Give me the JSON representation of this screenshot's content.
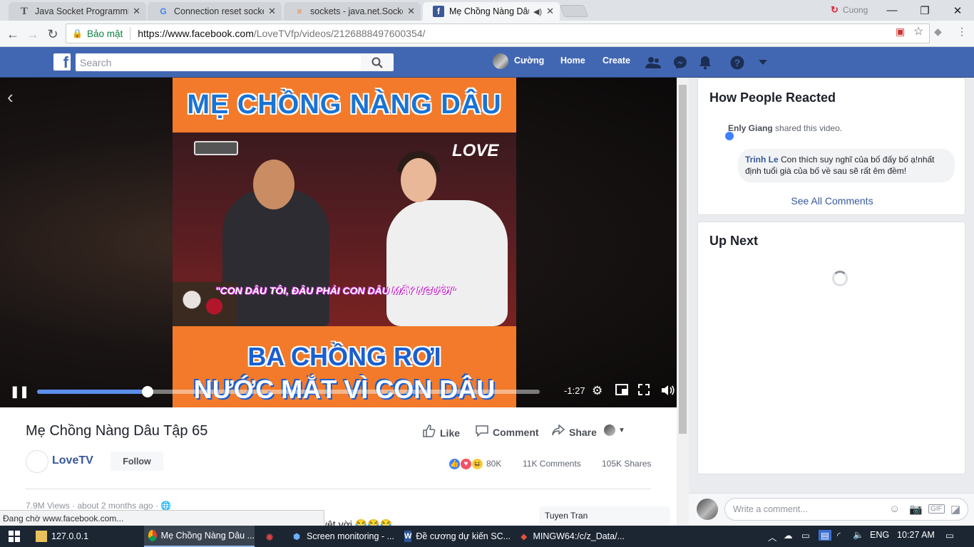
{
  "browser": {
    "tabs": [
      {
        "title": "Java Socket Programming",
        "icon": "T"
      },
      {
        "title": "Connection reset socket j",
        "icon": "G"
      },
      {
        "title": "sockets - java.net.SocketE",
        "icon": "stackoverflow-icon"
      },
      {
        "title": "Mẹ Chồng Nàng Dâu",
        "icon": "f",
        "active": true
      }
    ],
    "profile_name": "Cuong",
    "security_label": "Bảo mật",
    "url_host": "https://www.facebook.com",
    "url_path": "/LoveTVfp/videos/2126888497600354/"
  },
  "facebook": {
    "search_placeholder": "Search",
    "user_name": "Cường",
    "nav": [
      "Home",
      "Create"
    ]
  },
  "video": {
    "overlay_top": "MẸ CHỒNG NÀNG DÂU",
    "overlay_caption": "\"CON DÂU TÔI, ĐÂU PHẢI CON DÂU MẤY NGƯỜI\"",
    "overlay_bottom1": "BA CHỒNG RƠI",
    "overlay_bottom2": "NƯỚC MẮT VÌ CON DÂU",
    "watermark": "LOVE",
    "time_remaining": "-1:27",
    "progress": 0.22
  },
  "post": {
    "title": "Mẹ Chồng Nàng Dâu Tập 65",
    "actions": [
      "Like",
      "Comment",
      "Share"
    ],
    "page_name": "LoveTV",
    "follow_label": "Follow",
    "reactions_count": "80K",
    "comments_count": "11K Comments",
    "shares_count": "105K Shares",
    "views_line": "7.9M Views · about 2 months ago ·",
    "partial_text": "yêt vời 😂😂😂",
    "commenter_preview": "Tuyen Tran"
  },
  "status_bar": "Đang chờ www.facebook.com...",
  "sidebar": {
    "reacted_title": "How People Reacted",
    "share_user": "Enly Giang",
    "share_text": "shared this video.",
    "comment_user": "Trinh Le",
    "comment_text": "Con thích suy nghĩ của bố đấy bố ạ!nhất định tuổi già của bố về sau sẽ rất êm đềm!",
    "see_all": "See All Comments",
    "up_next_title": "Up Next",
    "comment_placeholder": "Write a comment..."
  },
  "taskbar": {
    "items": [
      {
        "label": "127.0.0.1"
      },
      {
        "label": "Mẹ Chồng Nàng Dâu ..."
      },
      {
        "label": ""
      },
      {
        "label": "Screen monitoring - ..."
      },
      {
        "label": "Đề cương dự kiến SC..."
      },
      {
        "label": "MINGW64:/c/z_Data/..."
      }
    ],
    "lang": "ENG",
    "time": "10:27 AM"
  },
  "colors": {
    "facebook_blue": "#4267b2",
    "link_blue": "#365899",
    "seek_fill": "#5b8fea",
    "taskbar_bg": "#1c2633"
  }
}
